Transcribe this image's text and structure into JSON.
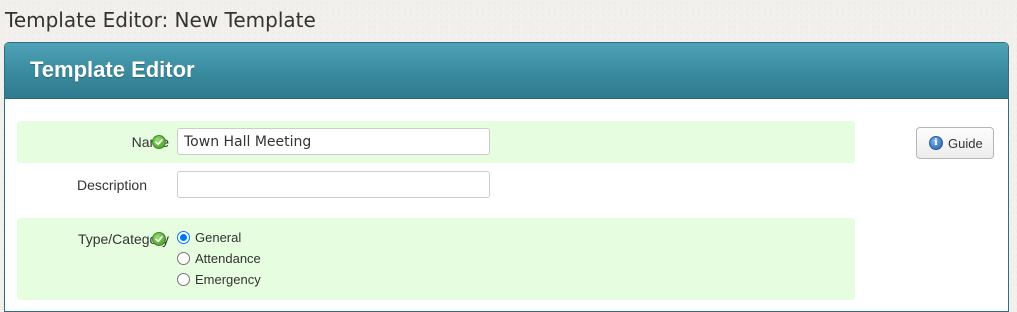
{
  "page": {
    "title": "Template Editor: New Template"
  },
  "panel": {
    "title": "Template Editor"
  },
  "form": {
    "name": {
      "label": "Name",
      "value": "Town Hall Meeting",
      "valid": true
    },
    "description": {
      "label": "Description",
      "value": ""
    },
    "type": {
      "label": "Type/Category",
      "valid": true,
      "options": [
        {
          "label": "General",
          "checked": true
        },
        {
          "label": "Attendance",
          "checked": false
        },
        {
          "label": "Emergency",
          "checked": false
        }
      ]
    }
  },
  "guide": {
    "label": "Guide",
    "icon": "info-icon"
  },
  "colors": {
    "header_bg": "#3d8ea2",
    "row_highlight": "#e6fde0",
    "valid_check": "#5fb23c",
    "radio_accent": "#0075ff"
  }
}
